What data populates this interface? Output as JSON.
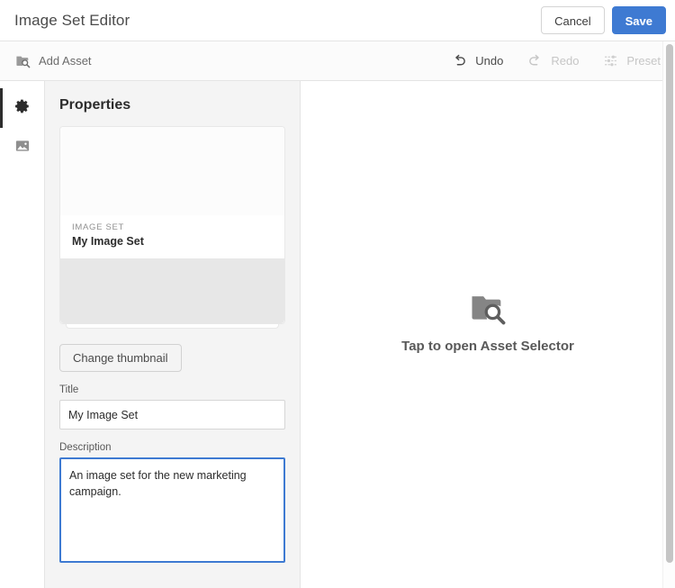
{
  "header": {
    "title": "Image Set Editor",
    "cancel_label": "Cancel",
    "save_label": "Save",
    "save_color": "#3e7ad2"
  },
  "toolbar": {
    "add_asset_label": "Add Asset",
    "add_asset_icon": "folder-search-icon",
    "undo_label": "Undo",
    "undo_icon": "undo-arrow-icon",
    "redo_label": "Redo",
    "redo_icon": "redo-arrow-icon",
    "preset_label": "Preset",
    "preset_icon": "sliders-icon"
  },
  "rail": {
    "items": [
      {
        "name": "properties",
        "icon": "gear-icon",
        "selected": true
      },
      {
        "name": "assets",
        "icon": "image-icon",
        "selected": false
      }
    ],
    "indicator_color": "#2d2d2d"
  },
  "panel": {
    "title": "Properties",
    "card": {
      "eyebrow": "IMAGE SET",
      "name": "My Image Set"
    },
    "change_thumbnail_label": "Change thumbnail",
    "title_field": {
      "label": "Title",
      "value": "My Image Set",
      "placeholder": "Title"
    },
    "description_field": {
      "label": "Description",
      "value": "An image set for the new marketing campaign.",
      "placeholder": "Description",
      "focus_color": "#3e7ad2"
    }
  },
  "canvas": {
    "drop_label": "Tap to open Asset Selector",
    "drop_icon": "folder-search-icon"
  },
  "scrollbar": {
    "name": "vertical-scrollbar",
    "thumb_color": "#c5c5c5"
  }
}
